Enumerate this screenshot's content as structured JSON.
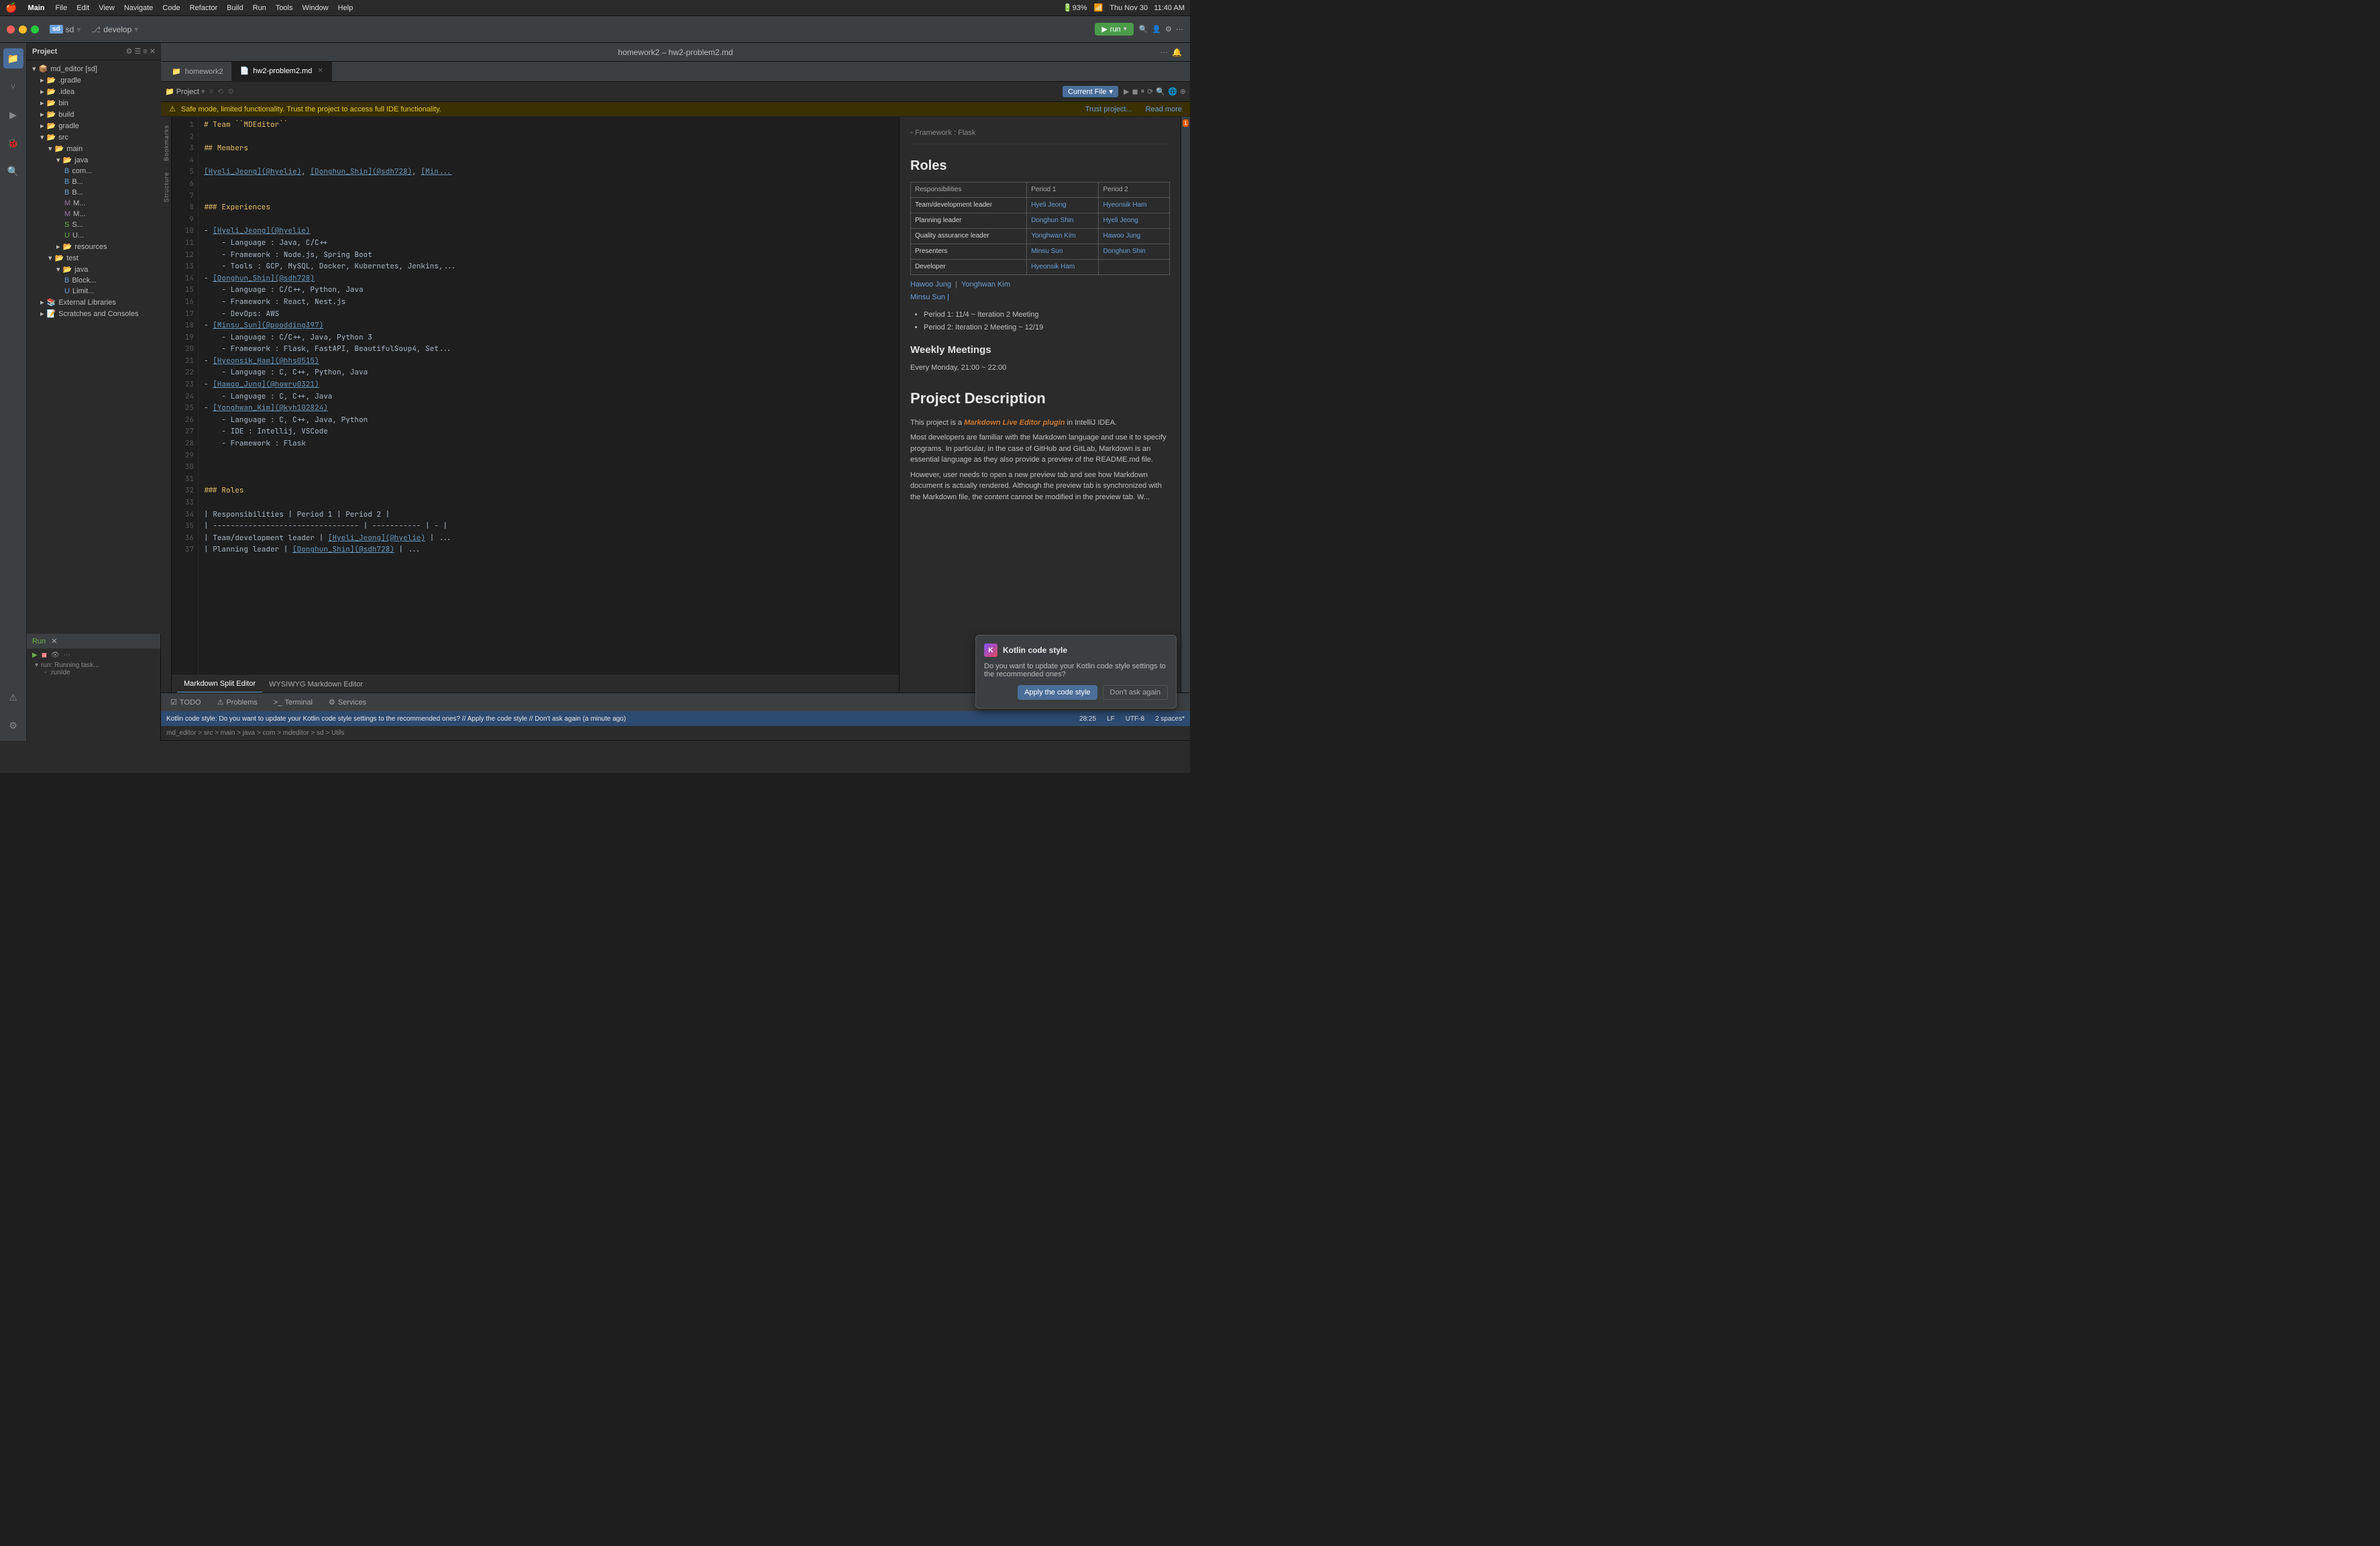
{
  "menubar": {
    "apple": "🍎",
    "app_name": "Main",
    "menus": [
      "File",
      "Edit",
      "View",
      "Navigate",
      "Code",
      "Refactor",
      "Build",
      "Run",
      "Tools",
      "Window",
      "Help"
    ],
    "right_items": [
      "93%",
      "Thu Nov 30",
      "11:40 AM"
    ]
  },
  "ide_toolbar": {
    "project_label": "sd",
    "branch_label": "develop",
    "run_label": "run",
    "window_title": "homework2 – hw2-problem2.md"
  },
  "project_panel": {
    "title": "Project",
    "root": "md_editor [sd]",
    "items": [
      ".gradle",
      ".idea",
      "bin",
      "build",
      "gradle",
      "src",
      "main",
      "java",
      "com...",
      "resources",
      "test",
      "java",
      "Block...",
      "Limit..."
    ]
  },
  "run_panel": {
    "title": "Run",
    "tab": "run",
    "running_label": "run: Running task...",
    "sub_label": ":runIde"
  },
  "tabs": {
    "tab1": "homework2",
    "tab2": "hw2-problem2.md"
  },
  "editor_toolbar": {
    "project_btn": "Project",
    "current_file_label": "Current File"
  },
  "safe_mode": {
    "message": "Safe mode, limited functionality. Trust the project to access full IDE functionality.",
    "trust_btn": "Trust project...",
    "read_more": "Read more"
  },
  "bottom_tabs": {
    "todo": "TODO",
    "problems": "Problems",
    "terminal": "Terminal",
    "services": "Services"
  },
  "status_bar": {
    "line_col": "28:25",
    "line_sep": "LF",
    "encoding": "UTF-8",
    "indent": "2 spaces*",
    "breadcrumb": "md_editor > src > main > java > com > mdeditor > sd > Utils"
  },
  "code_lines": [
    {
      "num": "1",
      "text": "# Team ``MDEditor``"
    },
    {
      "num": "2",
      "text": ""
    },
    {
      "num": "3",
      "text": "## Members"
    },
    {
      "num": "4",
      "text": ""
    },
    {
      "num": "5",
      "text": "[Hyeli_Jeong](@hyelie), [Donghun_Shin](@sdh728), [Min..."
    },
    {
      "num": "6",
      "text": ""
    },
    {
      "num": "7",
      "text": ""
    },
    {
      "num": "8",
      "text": "### Experiences"
    },
    {
      "num": "9",
      "text": ""
    },
    {
      "num": "10",
      "text": "- [Hyeli_Jeong](@hyelie)"
    },
    {
      "num": "11",
      "text": "    - Language : Java, C/C++"
    },
    {
      "num": "12",
      "text": "    - Framework : Node.js, Spring Boot"
    },
    {
      "num": "13",
      "text": "    - Tools : GCP, MySQL, Docker, Kubernetes, Jenkins,..."
    },
    {
      "num": "14",
      "text": "- [Donghun_Shin](@sdh728)"
    },
    {
      "num": "15",
      "text": "    - Language : C/C++, Python, Java"
    },
    {
      "num": "16",
      "text": "    - Framework : React, Nest.js"
    },
    {
      "num": "17",
      "text": "    - DevOps: AWS"
    },
    {
      "num": "18",
      "text": "- [Minsu_Sun](@poodding397)"
    },
    {
      "num": "19",
      "text": "    - Language : C/C++, Java, Python 3"
    },
    {
      "num": "20",
      "text": "    - Framework : Flask, FastAPI, BeautifulSoup4, Set..."
    },
    {
      "num": "21",
      "text": "- [Hyeonsik_Ham](@hhs0515)"
    },
    {
      "num": "22",
      "text": "    - Language : C, C++, Python, Java"
    },
    {
      "num": "23",
      "text": "- [Hawoo_Jung](@howru0321)"
    },
    {
      "num": "24",
      "text": "    - Language : C, C++, Java"
    },
    {
      "num": "25",
      "text": "- [Yonghwan_Kim](@kyh102824)"
    },
    {
      "num": "26",
      "text": "    - Language : C, C++, Java, Python"
    },
    {
      "num": "27",
      "text": "    - IDE : Intellij, VSCode"
    },
    {
      "num": "28",
      "text": "    - Framework : Flask"
    },
    {
      "num": "29",
      "text": ""
    },
    {
      "num": "30",
      "text": ""
    },
    {
      "num": "31",
      "text": ""
    },
    {
      "num": "32",
      "text": "### Roles"
    },
    {
      "num": "33",
      "text": ""
    },
    {
      "num": "34",
      "text": "| Responsibilities | Period 1 | Period 2 |"
    },
    {
      "num": "35",
      "text": "| ------------------------------------ | ------------ | - |"
    },
    {
      "num": "36",
      "text": "| Team/development leader | [Hyeli_Jeong](@hyelie) | ..."
    },
    {
      "num": "37",
      "text": "| Planning leader          | [Donghun_Shin](@sdh728) | ..."
    }
  ],
  "preview": {
    "framework_label": "Framework : Flask",
    "roles_heading": "Roles",
    "roles_table_intro": "| Responsibilities | Period 1 | Period 2 | |---... | Team/development leader | Hyeli Jeong | Hyeonsik Ham | Planning leader | Donghun Shin | Hyeli Jeong | Quality assurance leader | Yonghwan Kim | Hawoo Jung | Presenters | Minsu Sun | Donghun Shin | Developer | Hyeonsik Ham",
    "team_links_colored": [
      "Hawoo Jung",
      "Yonghwan Kim"
    ],
    "period_label_1": "Period 1: 11/4 ~ Iteration 2 Meeting",
    "period_label_2": "Period 2: Iteration 2 Meeting ~ 12/19",
    "weekly_heading": "Weekly Meetings",
    "weekly_time": "Every Monday, 21:00 ~ 22:00",
    "project_desc_heading": "Project Description",
    "project_desc_p1": "This project is a Markdown Live Editor plugin in IntelliJ IDEA.",
    "project_desc_p2": "Most developers are familiar with the Markdown language and use it to specify programs. In particular, in the case of GitHub and GitLab, Markdown is an essential language as they also provide a preview of the README.md file.",
    "project_desc_p3": "However, user needs to open a new preview tab and see how Markdown document is actually rendered. Although the preview tab is synchronized with the Markdown file, the content cannot be modified in the preview tab. W..."
  },
  "kotlin_popup": {
    "icon_letter": "K",
    "title": "Kotlin code style",
    "message": "Do you want to update your Kotlin code style settings to the recommended ones?",
    "apply_btn": "Apply the code style",
    "dismiss_btn": "Don't ask again"
  },
  "markdown_tabs": {
    "split": "Markdown Split Editor",
    "wysiwyg": "WYSIWYG Markdown Editor"
  }
}
